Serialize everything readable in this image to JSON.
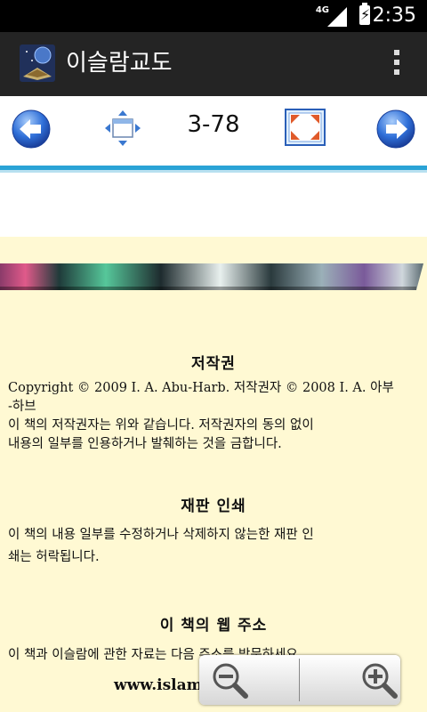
{
  "status_bar": {
    "network": "4G",
    "time": "2:35"
  },
  "app_bar": {
    "title": "이슬람교도",
    "overflow_icon": "overflow-menu-icon"
  },
  "toolbar": {
    "page": "3-78",
    "prev_icon": "back-arrow-icon",
    "move_icon": "move-icon",
    "fullscreen_icon": "fullscreen-icon",
    "next_icon": "forward-arrow-icon"
  },
  "content": {
    "copyright_heading": "저작권",
    "copyright_line1": "Copyright © 2009 I. A. Abu-Harb. 저작권자 © 2008 I. A. 아부",
    "copyright_line2": "-하브",
    "copyright_line3": "이 책의 저작권자는 위와 같습니다. 저작권자의 동의 없이",
    "copyright_line4": "내용의 일부를 인용하거나 발췌하는 것을 금합니다.",
    "reprint_heading": "재판 인쇄",
    "reprint_line1": "이 책의 내용 일부를 수정하거나 삭제하지 않는한 재판 인",
    "reprint_line2": "쇄는 허락됩니다.",
    "web_heading": "이 책의 웹 주소",
    "web_line1": "이 책과 이슬람에 관한 자료는 다음 주소를 방문하세요.",
    "url": "www.islam-g"
  },
  "zoom": {
    "out_icon": "zoom-out-icon",
    "in_icon": "zoom-in-icon"
  },
  "colors": {
    "content_bg": "#fff9d3",
    "accent": "#2aa3d6",
    "action_bar": "#242424"
  }
}
